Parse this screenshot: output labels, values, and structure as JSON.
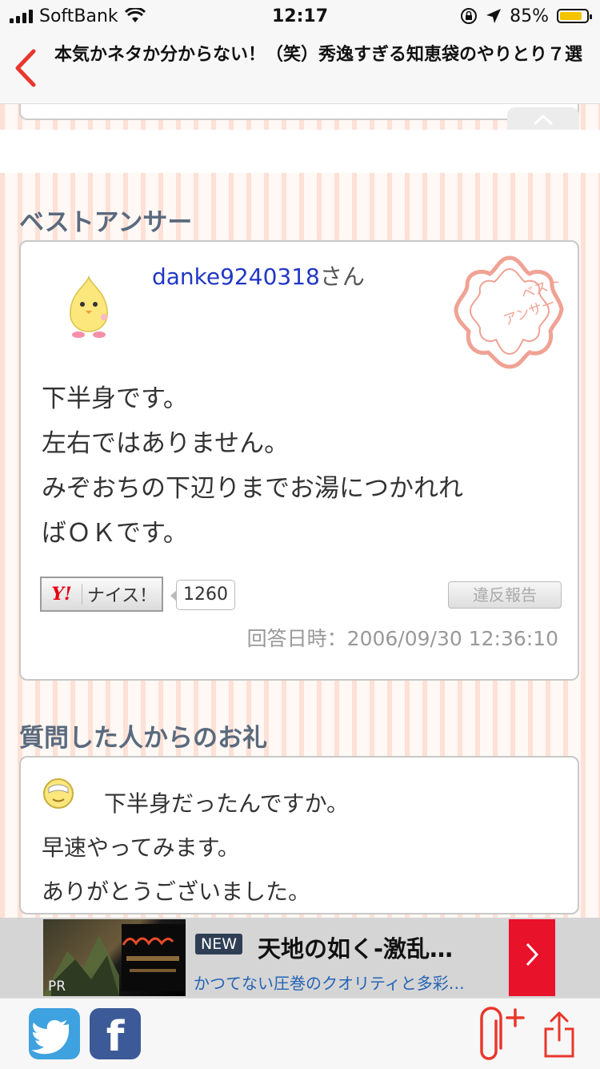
{
  "status_bar": {
    "carrier": "SoftBank",
    "time": "12:17",
    "battery_percent": "85%",
    "battery_level": 0.85
  },
  "nav": {
    "back_icon": "chevron-left-icon",
    "title": "本気かネタか分からない！（笑）秀逸すぎる知恵袋のやりとり７選"
  },
  "best_answer": {
    "heading": "ベストアンサー",
    "user_id": "danke9240318",
    "user_suffix": "さん",
    "stamp_text": "ベストアンサー",
    "body": [
      "下半身です。",
      "左右ではありません。",
      "みぞおちの下辺りまでお湯につかれれ",
      "ばＯＫです。"
    ],
    "nice_label": "ナイス！",
    "nice_logo": "Y!",
    "nice_count": "1260",
    "report_label": "違反報告",
    "answered_at": "回答日時：2006/09/30 12:36:10"
  },
  "thanks": {
    "heading": "質問した人からのお礼",
    "body": [
      "下半身だったんですか。",
      "早速やってみます。",
      "ありがとうございました。"
    ]
  },
  "ad": {
    "pr_label": "PR",
    "new_badge": "NEW",
    "title": "天地の如く-激乱…",
    "subtitle": "かつてない圧巻のクオリティと多彩…",
    "arrow": ">"
  },
  "colors": {
    "accent": "#e8372c",
    "link": "#2237c6",
    "heading": "#5a6a7e",
    "stripe": "#fde1d6"
  }
}
